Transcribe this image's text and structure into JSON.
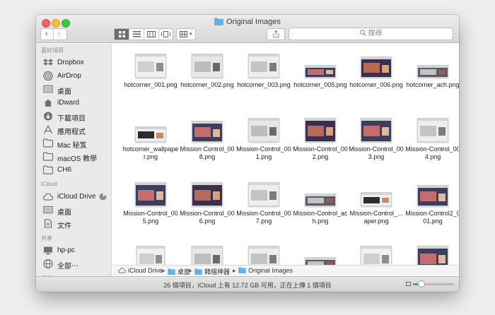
{
  "window": {
    "title": "Original Images"
  },
  "search": {
    "placeholder": "搜尋"
  },
  "view_modes": [
    "icon",
    "list",
    "column",
    "cover-flow"
  ],
  "sidebar": {
    "sections": [
      {
        "header": "喜好項目",
        "items": [
          {
            "label": "Dropbox",
            "icon": "dropbox-icon"
          },
          {
            "label": "AirDrop",
            "icon": "airdrop-icon"
          },
          {
            "label": "桌面",
            "icon": "desktop-icon"
          },
          {
            "label": "iDward",
            "icon": "home-icon"
          },
          {
            "label": "下載項目",
            "icon": "downloads-icon"
          },
          {
            "label": "應用程式",
            "icon": "applications-icon"
          },
          {
            "label": "Mac 秘笈",
            "icon": "folder-icon"
          },
          {
            "label": "macOS 教學",
            "icon": "folder-icon"
          },
          {
            "label": "CH6",
            "icon": "folder-icon"
          }
        ]
      },
      {
        "header": "iCloud",
        "items": [
          {
            "label": "iCloud Drive",
            "icon": "icloud-icon"
          },
          {
            "label": "桌面",
            "icon": "desktop-icon"
          },
          {
            "label": "文件",
            "icon": "document-icon"
          }
        ]
      },
      {
        "header": "共享",
        "items": [
          {
            "label": "hp-pc",
            "icon": "computer-icon"
          },
          {
            "label": "全部⋯",
            "icon": "network-icon"
          }
        ]
      },
      {
        "header": "標記",
        "items": []
      }
    ]
  },
  "files": [
    {
      "name": "hotcorner_001.png"
    },
    {
      "name": "hotcorner_002.png"
    },
    {
      "name": "hotcorner_003.png"
    },
    {
      "name": "hotcorner_005.png"
    },
    {
      "name": "hotcorner_006.png"
    },
    {
      "name": "hotcorner_ach.png"
    },
    {
      "name": "hotcorner_wallpaper.png"
    },
    {
      "name": "Mission Control_008.png"
    },
    {
      "name": "Mission-Control_001.png"
    },
    {
      "name": "Mission-Control_002.png"
    },
    {
      "name": "Mission-Control_003.png"
    },
    {
      "name": "Mission-Control_004.png"
    },
    {
      "name": "Mission-Control_005.png"
    },
    {
      "name": "Mission-Control_006.png"
    },
    {
      "name": "Mission-Control_007.png"
    },
    {
      "name": "Mission-Control_ach.png"
    },
    {
      "name": "Mission-Control_...aper.png"
    },
    {
      "name": "Mission-Control2_001.png"
    },
    {
      "name": ""
    },
    {
      "name": ""
    },
    {
      "name": ""
    },
    {
      "name": ""
    },
    {
      "name": ""
    },
    {
      "name": ""
    }
  ],
  "path": [
    "iCloud Drive",
    "桌面",
    "韓檔神器",
    "Original Images"
  ],
  "status": {
    "text": "26 個項目，iCloud 上有 12.72 GB 可用，正在上傳 1 個項目"
  },
  "zoom_level": 0.2,
  "colors": {
    "folder": "#5fb2ea",
    "accent": "#4a90e2"
  }
}
